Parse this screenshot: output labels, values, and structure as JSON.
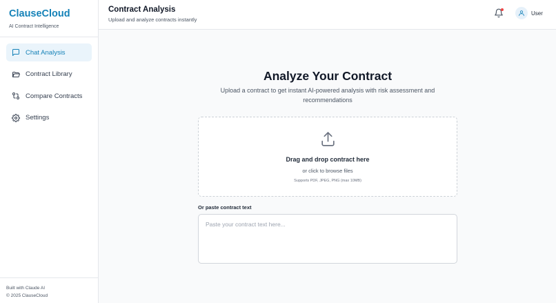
{
  "app": {
    "name": "ClauseCloud",
    "tagline": "AI Contract Intelligence",
    "brand_color": "#1582b8"
  },
  "sidebar": {
    "items": [
      {
        "label": "Chat Analysis",
        "icon": "chat-icon",
        "active": true
      },
      {
        "label": "Contract Library",
        "icon": "folder-icon",
        "active": false
      },
      {
        "label": "Compare Contracts",
        "icon": "compare-icon",
        "active": false
      },
      {
        "label": "Settings",
        "icon": "gear-icon",
        "active": false
      }
    ],
    "footer": {
      "line1": "Built with Claude AI",
      "line2": "© 2025 ClauseCloud"
    }
  },
  "header": {
    "title": "Contract Analysis",
    "subtitle": "Upload and analyze contracts instantly",
    "notification_icon": "bell-icon",
    "notification_dot_color": "#ef4444",
    "user_label": "User"
  },
  "main": {
    "heading": "Analyze Your Contract",
    "description": "Upload a contract to get instant AI-powered analysis with risk assessment and recommendations",
    "dropzone": {
      "icon": "upload-icon",
      "title": "Drag and drop contract here",
      "subtitle": "or click to browse files",
      "hint": "Supports PDF, JPEG, PNG (max 10MB)"
    },
    "paste": {
      "label": "Or paste contract text",
      "placeholder": "Paste your contract text here...",
      "value": ""
    }
  }
}
